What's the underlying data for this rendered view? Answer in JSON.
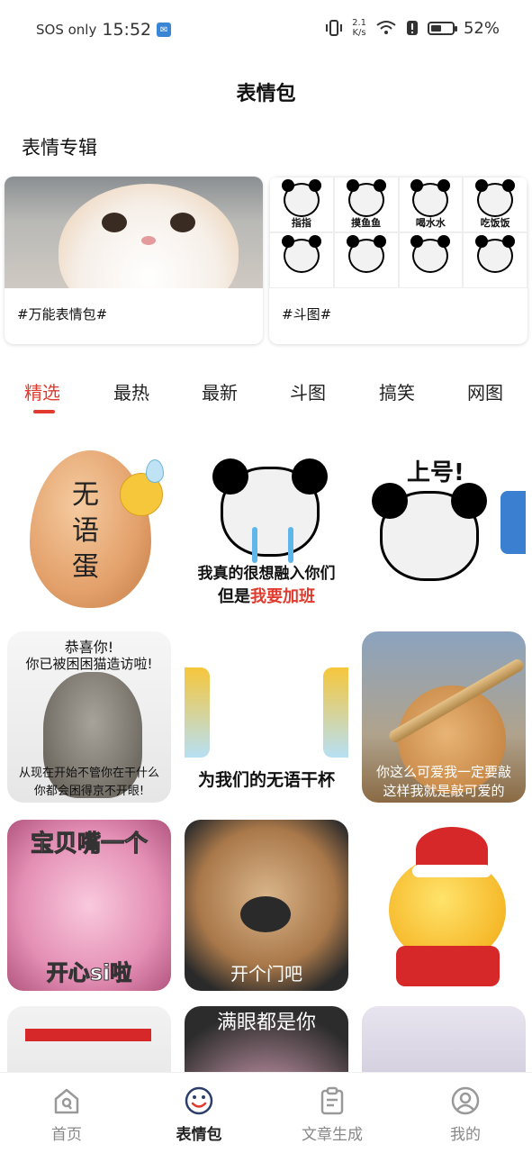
{
  "status_bar": {
    "carrier": "SOS only",
    "time": "15:52",
    "net_speed_value": "2.1",
    "net_speed_unit": "K/s",
    "battery_percent": "52%",
    "battery_level": 0.52
  },
  "header": {
    "title": "表情包"
  },
  "albums_section": {
    "title": "表情专辑",
    "albums": [
      {
        "label": "#万能表情包#"
      },
      {
        "label": "#斗图#",
        "grid_captions": [
          "指指",
          "摸鱼鱼",
          "喝水水",
          "吃饭饭",
          "",
          "",
          "",
          ""
        ]
      }
    ]
  },
  "tabs": [
    {
      "label": "精选"
    },
    {
      "label": "最热"
    },
    {
      "label": "最新"
    },
    {
      "label": "斗图"
    },
    {
      "label": "搞笑"
    },
    {
      "label": "网图"
    }
  ],
  "stickers": [
    {
      "text": "无语蛋"
    },
    {
      "line1": "我真的很想融入你们",
      "line2a": "但是",
      "line2b": "我要加班"
    },
    {
      "text": "上号!"
    },
    {
      "top1": "恭喜你!",
      "top2": "你已被困困猫造访啦!",
      "bottom1": "从现在开始不管你在干什么",
      "bottom2": "你都会困得京不开眼!"
    },
    {
      "text": "为我们的无语干杯"
    },
    {
      "line1": "你这么可爱我一定要敲",
      "line2": "这样我就是敲可爱的"
    },
    {
      "top": "宝贝嘴一个",
      "bottom": "开心si啦"
    },
    {
      "bottom": "开个门吧"
    },
    {
      "text": ""
    },
    {
      "text": ""
    },
    {
      "top": "满眼都是你"
    },
    {
      "text": ""
    }
  ],
  "bottom_nav": [
    {
      "label": "首页",
      "icon": "home-icon"
    },
    {
      "label": "表情包",
      "icon": "smile-icon"
    },
    {
      "label": "文章生成",
      "icon": "clipboard-icon"
    },
    {
      "label": "我的",
      "icon": "user-icon"
    }
  ],
  "colors": {
    "accent": "#e03b2e"
  }
}
